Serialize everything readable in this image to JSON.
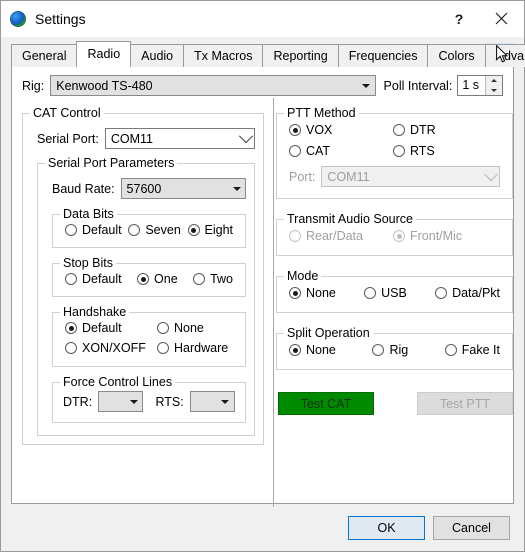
{
  "window": {
    "title": "Settings",
    "icon": "globe-icon",
    "help_label": "?",
    "close_label": "×"
  },
  "tabs": [
    {
      "label": "General",
      "selected": false
    },
    {
      "label": "Radio",
      "selected": true
    },
    {
      "label": "Audio",
      "selected": false
    },
    {
      "label": "Tx Macros",
      "selected": false
    },
    {
      "label": "Reporting",
      "selected": false
    },
    {
      "label": "Frequencies",
      "selected": false
    },
    {
      "label": "Colors",
      "selected": false
    },
    {
      "label": "Advanced",
      "selected": false
    }
  ],
  "rig_row": {
    "rig_label": "Rig:",
    "rig_value": "Kenwood TS-480",
    "poll_label": "Poll Interval:",
    "poll_value": "1 s"
  },
  "cat_control": {
    "title": "CAT Control",
    "serial_port_label": "Serial Port:",
    "serial_port_value": "COM11",
    "serial_params": {
      "title": "Serial Port Parameters",
      "baud_label": "Baud Rate:",
      "baud_value": "57600",
      "data_bits": {
        "title": "Data Bits",
        "options": [
          {
            "label": "Default",
            "selected": false
          },
          {
            "label": "Seven",
            "selected": false
          },
          {
            "label": "Eight",
            "selected": true
          }
        ]
      },
      "stop_bits": {
        "title": "Stop Bits",
        "options": [
          {
            "label": "Default",
            "selected": false
          },
          {
            "label": "One",
            "selected": true
          },
          {
            "label": "Two",
            "selected": false
          }
        ]
      },
      "handshake": {
        "title": "Handshake",
        "options": [
          {
            "label": "Default",
            "selected": true
          },
          {
            "label": "None",
            "selected": false
          },
          {
            "label": "XON/XOFF",
            "selected": false
          },
          {
            "label": "Hardware",
            "selected": false
          }
        ]
      },
      "force_control_lines": {
        "title": "Force Control Lines",
        "dtr_label": "DTR:",
        "dtr_value": "",
        "rts_label": "RTS:",
        "rts_value": ""
      }
    }
  },
  "ptt_method": {
    "title": "PTT Method",
    "options": [
      {
        "label": "VOX",
        "selected": true
      },
      {
        "label": "DTR",
        "selected": false
      },
      {
        "label": "CAT",
        "selected": false
      },
      {
        "label": "RTS",
        "selected": false
      }
    ],
    "port_label": "Port:",
    "port_value": "COM11",
    "port_disabled": true
  },
  "transmit_audio_source": {
    "title": "Transmit Audio Source",
    "disabled": true,
    "options": [
      {
        "label": "Rear/Data",
        "selected": false
      },
      {
        "label": "Front/Mic",
        "selected": true
      }
    ]
  },
  "mode": {
    "title": "Mode",
    "options": [
      {
        "label": "None",
        "selected": true
      },
      {
        "label": "USB",
        "selected": false
      },
      {
        "label": "Data/Pkt",
        "selected": false
      }
    ]
  },
  "split_operation": {
    "title": "Split Operation",
    "options": [
      {
        "label": "None",
        "selected": true
      },
      {
        "label": "Rig",
        "selected": false
      },
      {
        "label": "Fake It",
        "selected": false
      }
    ]
  },
  "test_buttons": {
    "test_cat_label": "Test CAT",
    "test_cat_color": "#008a00",
    "test_ptt_label": "Test PTT",
    "test_ptt_disabled": true
  },
  "footer": {
    "ok_label": "OK",
    "cancel_label": "Cancel"
  }
}
